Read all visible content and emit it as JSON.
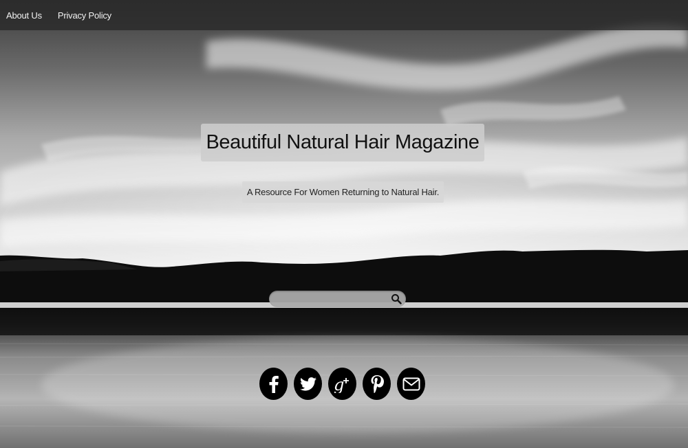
{
  "nav": {
    "items": [
      {
        "label": "About Us"
      },
      {
        "label": "Privacy Policy"
      }
    ]
  },
  "hero": {
    "title": "Beautiful Natural Hair Magazine",
    "tagline": "A Resource For Women Returning to Natural Hair."
  },
  "search": {
    "value": "",
    "placeholder": "",
    "button_icon": "search-icon"
  },
  "social": {
    "icons": [
      "facebook-icon",
      "twitter-icon",
      "google-plus-icon",
      "pinterest-icon",
      "email-icon"
    ]
  },
  "colors": {
    "nav_bg": "#2a2a2a",
    "nav_text": "#f2f2f2",
    "title_box_bg": "#cdcdcd",
    "social_bg": "#000000",
    "social_fg": "#ffffff"
  }
}
